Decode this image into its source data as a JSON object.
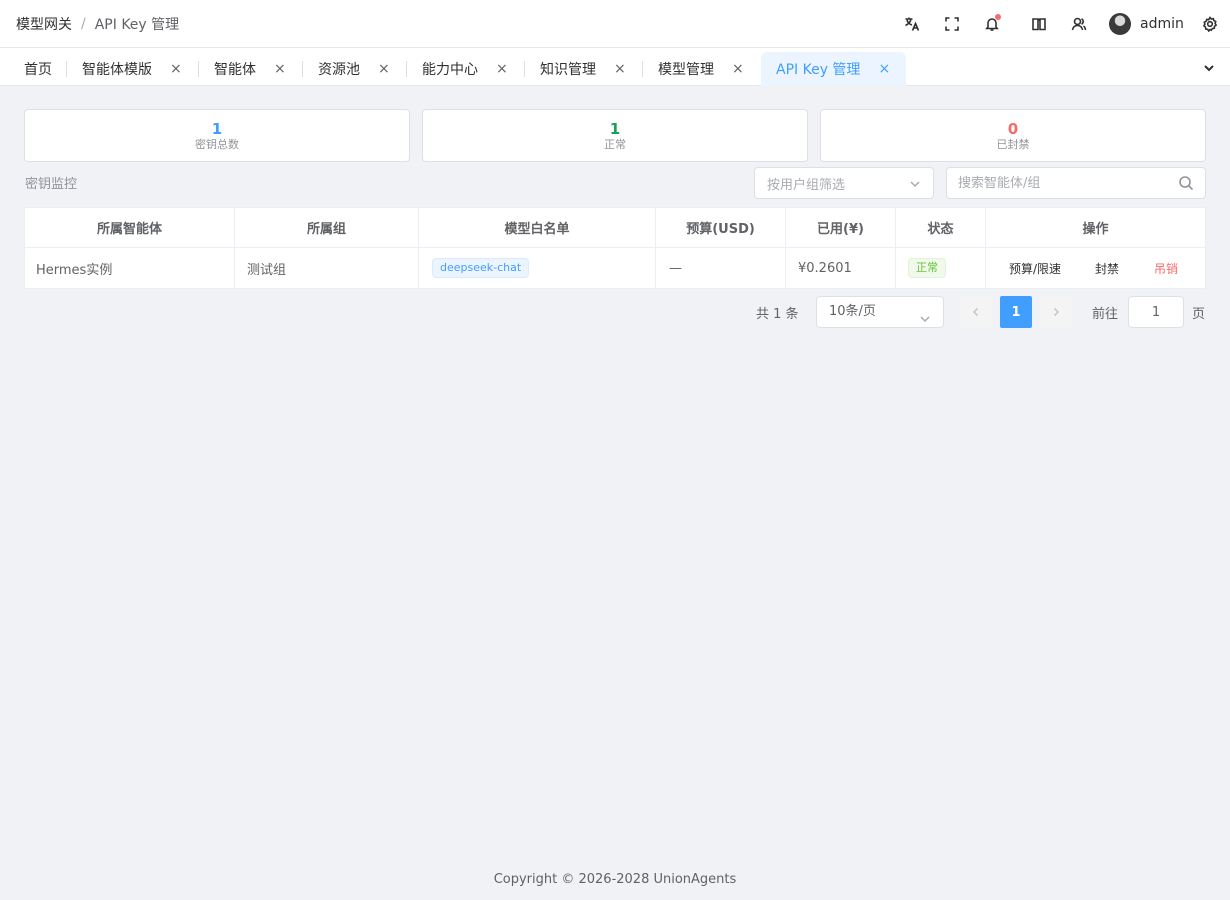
{
  "breadcrumb": {
    "root": "模型网关",
    "separator": "/",
    "current": "API Key 管理"
  },
  "header": {
    "icons": [
      "translate-icon",
      "fullscreen-icon",
      "bell-icon",
      "book-icon",
      "users-icon",
      "settings-icon"
    ],
    "username": "admin"
  },
  "tabs": [
    {
      "label": "首页"
    },
    {
      "label": "智能体模版"
    },
    {
      "label": "智能体"
    },
    {
      "label": "资源池"
    },
    {
      "label": "能力中心"
    },
    {
      "label": "知识管理"
    },
    {
      "label": "模型管理"
    },
    {
      "label": "API Key 管理"
    }
  ],
  "tab_close": "×",
  "stats": [
    {
      "value": "1",
      "label": "密钥总数",
      "color": "#409eff"
    },
    {
      "value": "1",
      "label": "正常",
      "color": "#18a058"
    },
    {
      "value": "0",
      "label": "已封禁",
      "color": "#f56c6c"
    }
  ],
  "section_title": "密钥监控",
  "filter": {
    "group_placeholder": "按用户组筛选",
    "search_placeholder": "搜索智能体/组"
  },
  "table": {
    "columns": [
      "所属智能体",
      "所属组",
      "模型白名单",
      "预算(USD)",
      "已用(¥)",
      "状态",
      "操作"
    ],
    "rows": [
      {
        "agent": "Hermes实例",
        "group": "测试组",
        "whitelist": "deepseek-chat",
        "budget": "—",
        "used": "¥0.2601",
        "status": "正常",
        "actions": [
          "预算/限速",
          "封禁",
          "吊销"
        ]
      }
    ]
  },
  "pagination": {
    "total": "共 1 条",
    "page_size": "10条/页",
    "current_page": "1",
    "goto_prefix": "前往",
    "goto_value": "1",
    "goto_suffix": "页"
  },
  "footer": "Copyright © 2026-2028 UnionAgents"
}
